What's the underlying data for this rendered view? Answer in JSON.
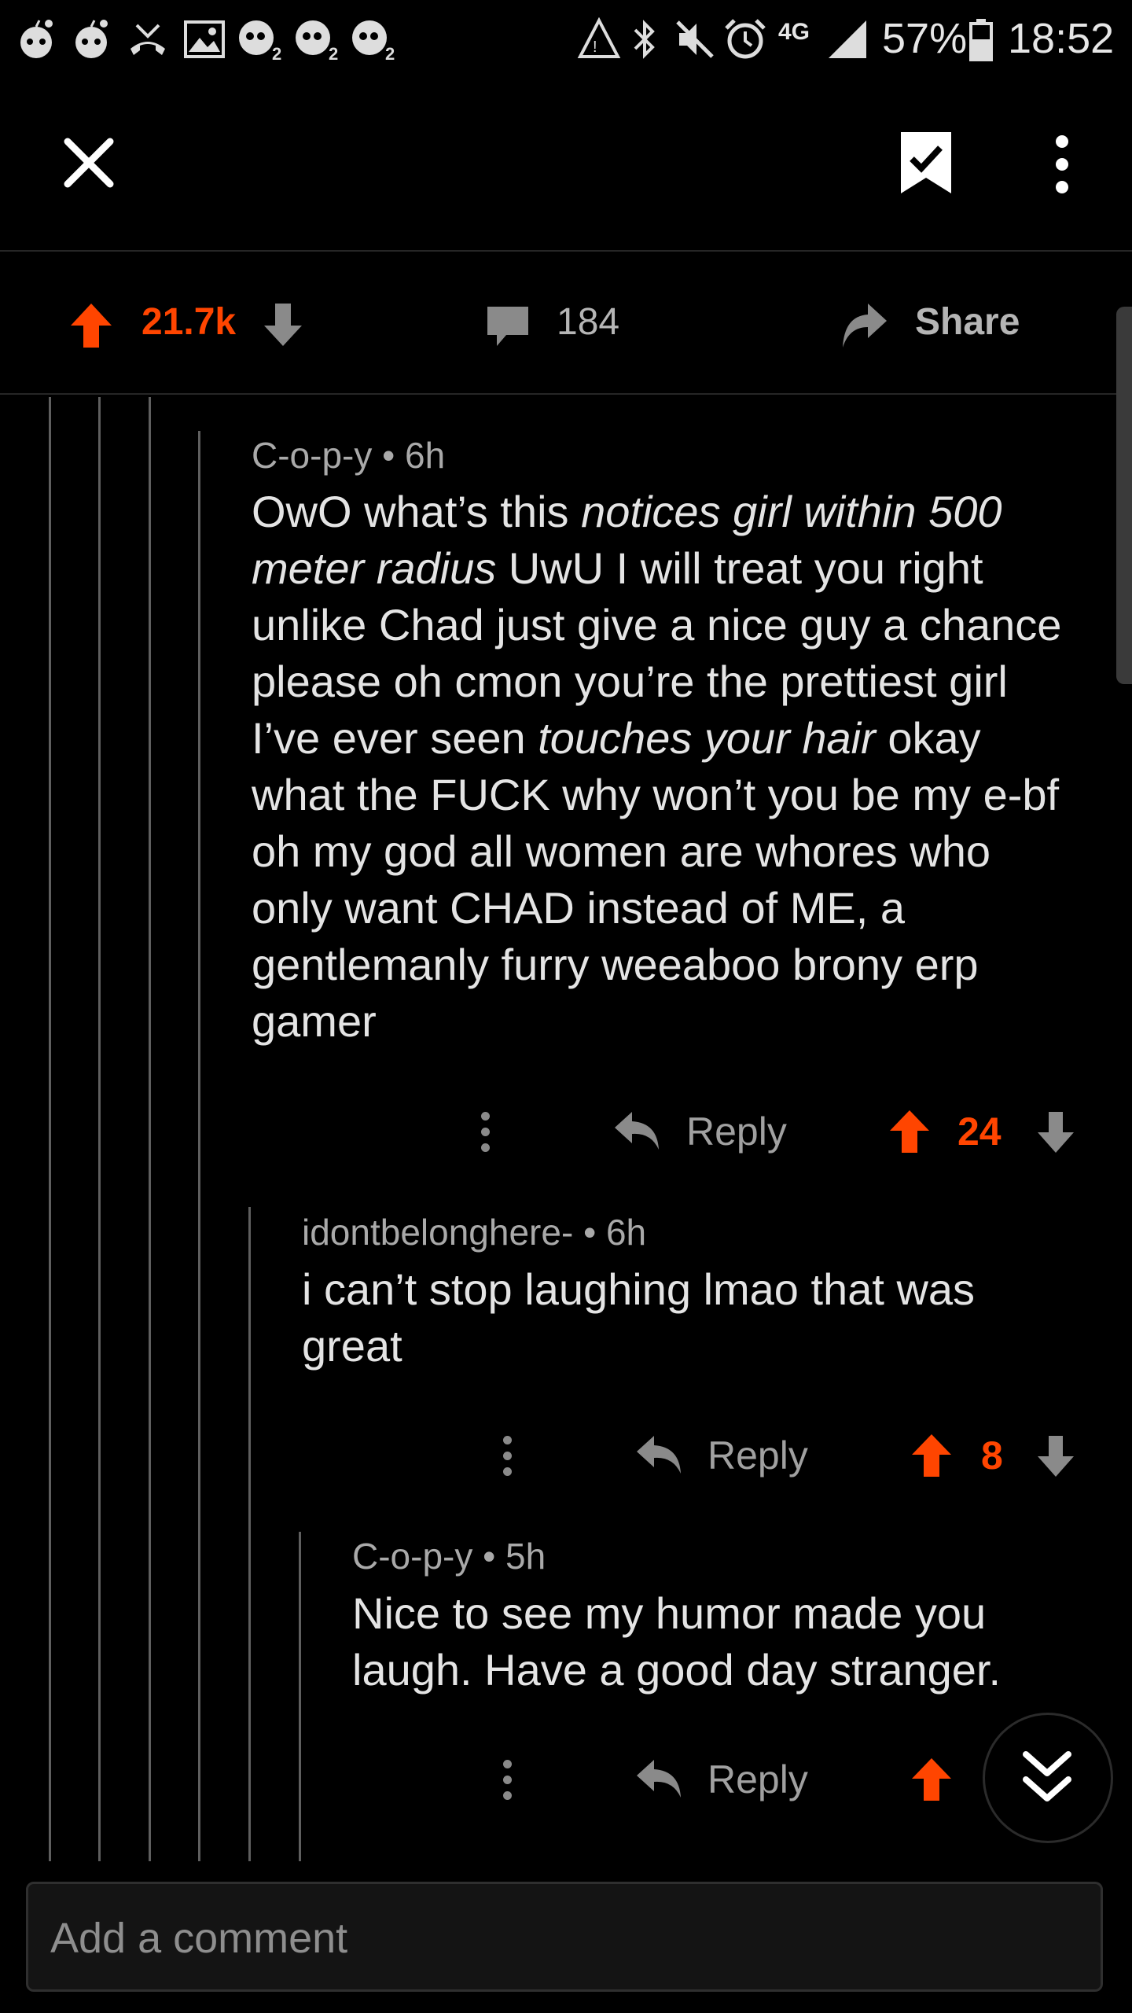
{
  "status_bar": {
    "battery_percent": "57%",
    "time": "18:52",
    "network": "4G",
    "notification_badges": [
      "2",
      "2",
      "2"
    ]
  },
  "toolbar": {
    "close_icon": "close-icon",
    "save_icon": "bookmark-check-icon",
    "more_icon": "more-vertical-icon"
  },
  "post_actions": {
    "score": "21.7k",
    "comments": "184",
    "share_label": "Share",
    "accent": "#ff4500"
  },
  "comments": [
    {
      "author": "C-o-p-y",
      "age": "6h",
      "body_parts": [
        {
          "text": "OwO what’s this ",
          "italic": false
        },
        {
          "text": "notices girl within 500 meter radius",
          "italic": true
        },
        {
          "text": " UwU I will treat you right unlike Chad just give a nice guy a chance please oh cmon you’re the prettiest girl I’ve ever seen ",
          "italic": false
        },
        {
          "text": "touches your hair",
          "italic": true
        },
        {
          "text": " okay what the FUCK why won’t you be my e-bf oh my god all women are whores who only want CHAD instead of ME, a gentlemanly furry weeaboo brony erp gamer",
          "italic": false
        }
      ],
      "reply_label": "Reply",
      "score": "24"
    },
    {
      "author": "idontbelonghere-",
      "age": "6h",
      "body": "i can’t stop laughing lmao that was great",
      "reply_label": "Reply",
      "score": "8"
    },
    {
      "author": "C-o-p-y",
      "age": "5h",
      "body": "Nice to see my humor made you laugh. Have a good day stranger.",
      "reply_label": "Reply"
    }
  ],
  "comment_input": {
    "placeholder": "Add a comment"
  }
}
